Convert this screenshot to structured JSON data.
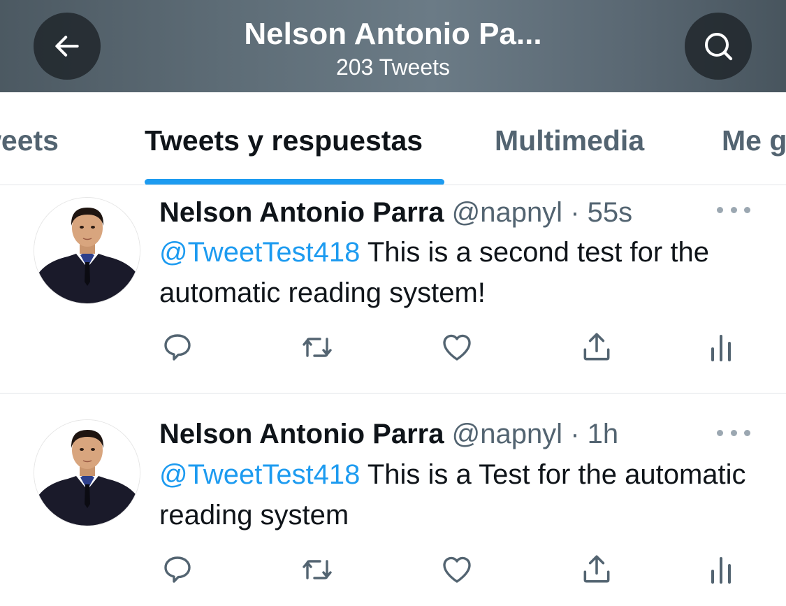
{
  "header": {
    "title": "Nelson Antonio Pa...",
    "subtitle": "203 Tweets",
    "back_icon": "arrow-left-icon",
    "search_icon": "search-icon"
  },
  "tabs": [
    {
      "label": "Tweets",
      "active": false
    },
    {
      "label": "Tweets y respuestas",
      "active": true
    },
    {
      "label": "Multimedia",
      "active": false
    },
    {
      "label": "Me gusta",
      "active": false
    }
  ],
  "tweets": [
    {
      "name": "Nelson Antonio Parra",
      "handle": "@napnyl",
      "separator": "·",
      "time": "55s",
      "mention": "@TweetTest418",
      "text": " This is a second test for the automatic reading system!"
    },
    {
      "name": "Nelson Antonio Parra",
      "handle": "@napnyl",
      "separator": "·",
      "time": "1h",
      "mention": "@TweetTest418",
      "text": " This is a Test for the automatic reading system"
    }
  ],
  "colors": {
    "accent": "#1d9bf0",
    "text_primary": "#0f1419",
    "text_secondary": "#536471",
    "divider": "#e3e6e9"
  }
}
